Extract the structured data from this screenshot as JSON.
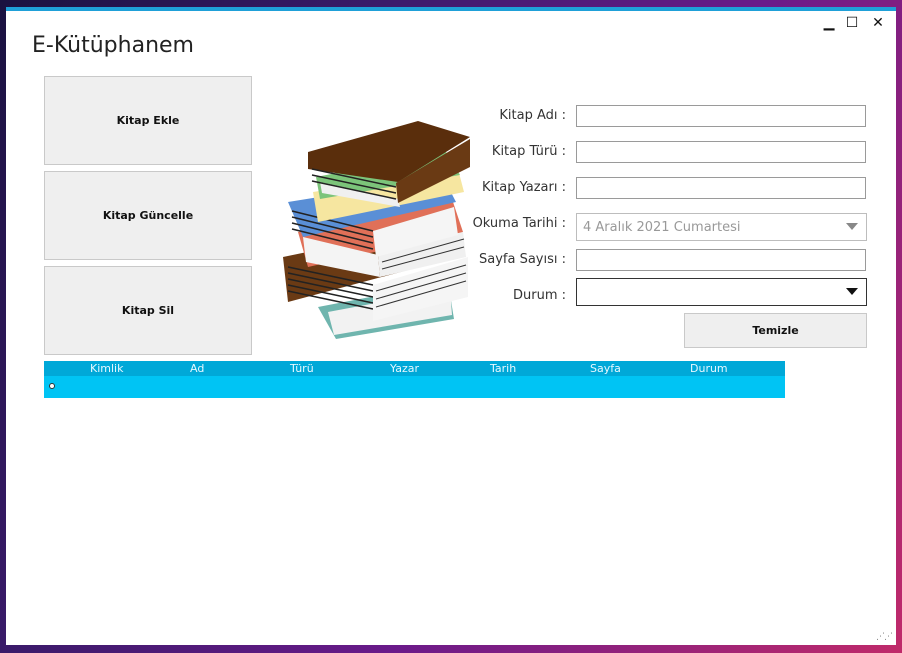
{
  "app": {
    "title": "E-Kütüphanem"
  },
  "window_controls": {
    "minimize": "▁",
    "maximize": "☐",
    "close": "✕"
  },
  "actions": {
    "add": "Kitap Ekle",
    "update": "Kitap Güncelle",
    "delete": "Kitap Sil",
    "clear": "Temizle"
  },
  "form": {
    "name_label": "Kitap  Adı :",
    "name_value": "",
    "type_label": "Kitap Türü :",
    "type_value": "",
    "author_label": "Kitap  Yazarı :",
    "author_value": "",
    "date_label": "Okuma Tarihi :",
    "date_value": "4 Aralık 2021 Cumartesi",
    "pages_label": "Sayfa Sayısı :",
    "pages_value": "",
    "status_label": "Durum :",
    "status_value": ""
  },
  "table": {
    "columns": [
      "Kimlik",
      "Ad",
      "Türü",
      "Yazar",
      "Tarih",
      "Sayfa",
      "Durum"
    ],
    "rows": []
  },
  "colors": {
    "accent": "#1fa0d8",
    "grid_bg": "#00c4f4",
    "grid_header": "#00a8d8"
  }
}
